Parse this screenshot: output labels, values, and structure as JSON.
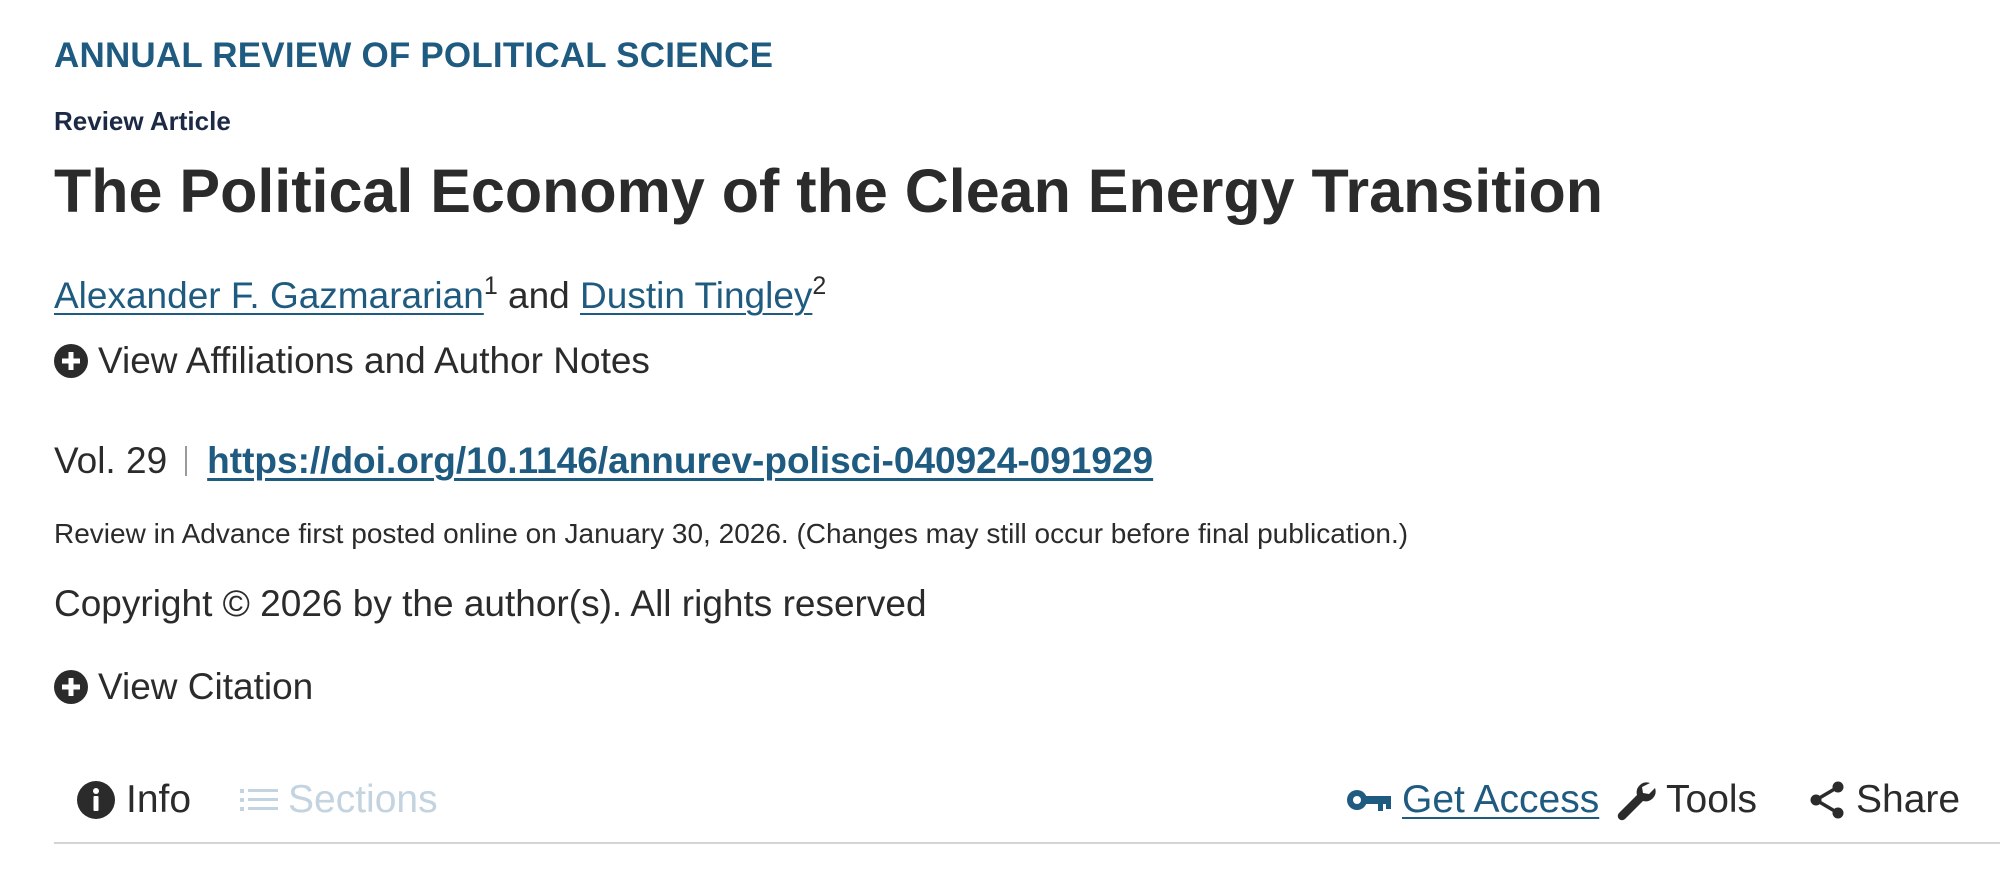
{
  "journal": "ANNUAL REVIEW OF POLITICAL SCIENCE",
  "article_type": "Review Article",
  "title": "The Political Economy of the Clean Energy Transition",
  "authors": {
    "author1": {
      "name": "Alexander F. Gazmararian",
      "sup": "1"
    },
    "joiner": "and",
    "author2": {
      "name": "Dustin Tingley",
      "sup": "2"
    }
  },
  "affiliations_toggle": "View Affiliations and Author Notes",
  "volume": "Vol. 29",
  "doi": "https://doi.org/10.1146/annurev-polisci-040924-091929",
  "posted": "Review in Advance first posted online on January 30, 2026. (Changes may still occur before final publication.)",
  "copyright": "Copyright © 2026 by the author(s). All rights reserved",
  "citation_toggle": "View Citation",
  "toolbar": {
    "info": "Info",
    "sections": "Sections",
    "get_access": "Get Access",
    "tools": "Tools",
    "share": "Share"
  },
  "icons": {
    "expand": "plus-circle-icon",
    "info": "info-icon",
    "sections": "list-icon",
    "access": "key-icon",
    "tools": "wrench-icon",
    "share": "share-icon"
  },
  "colors": {
    "link": "#1f5b80",
    "text": "#2b2b2b",
    "disabled": "#c3d3df",
    "heading_dark": "#1c2a45"
  }
}
